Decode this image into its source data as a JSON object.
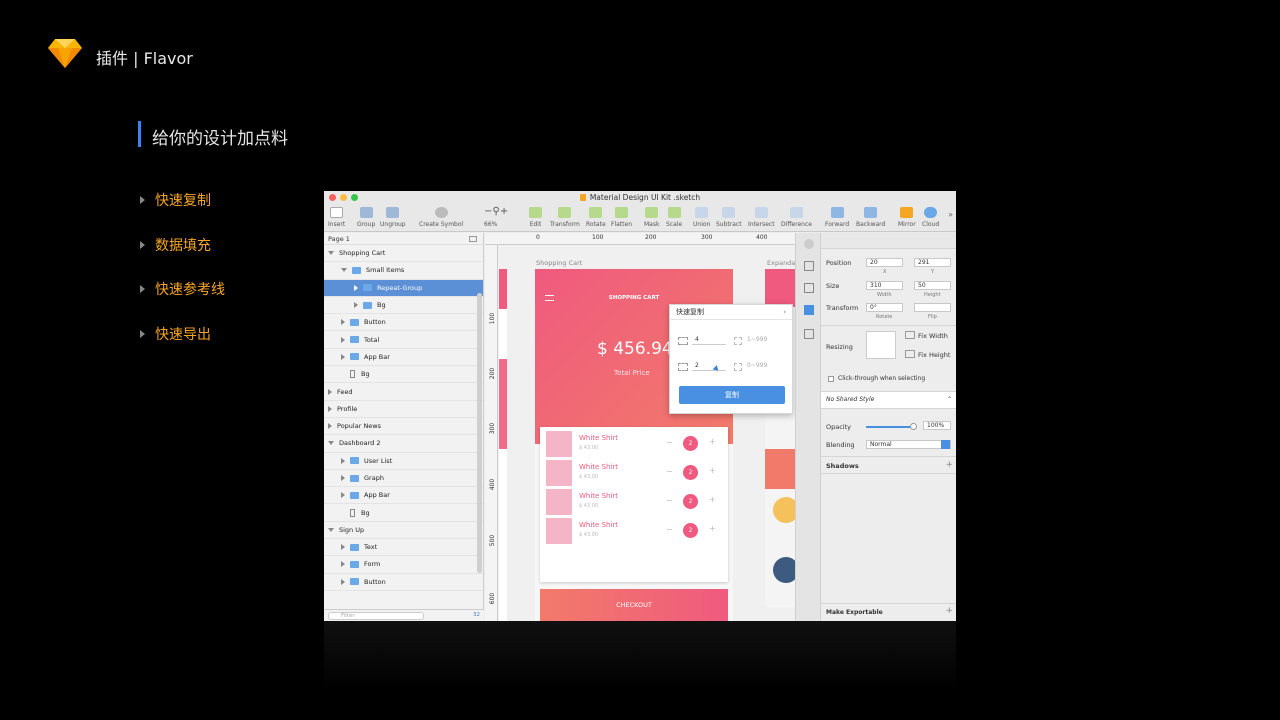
{
  "header": {
    "title": "插件 | Flavor",
    "logo_icon": "sketch-diamond-icon"
  },
  "section": {
    "title": "给你的设计加点料"
  },
  "bullets": [
    "快速复制",
    "数据填充",
    "快速参考线",
    "快速导出"
  ],
  "colors": {
    "accent": "#f5a623",
    "bar": "#3b82f6",
    "pink": "#ef5a7e",
    "selection": "#5b8fd6"
  },
  "window": {
    "title": "Material Design UI Kit .sketch",
    "toolbar": {
      "left": [
        "Insert",
        "Group",
        "Ungroup",
        "Create Symbol"
      ],
      "zoom": "66%",
      "middle": [
        "Edit",
        "Transform",
        "Rotate",
        "Flatten",
        "Mask",
        "Scale",
        "Union",
        "Subtract",
        "Intersect",
        "Difference"
      ],
      "right": [
        "Forward",
        "Backward",
        "Mirror",
        "Cloud"
      ]
    },
    "page": "Page 1",
    "layers": [
      {
        "label": "Shopping Cart",
        "indent": 0,
        "arrow": "d",
        "icon": "none",
        "selected": false
      },
      {
        "label": "Small Items",
        "indent": 1,
        "arrow": "d",
        "icon": "folder",
        "selected": false
      },
      {
        "label": "Repeat-Group",
        "indent": 2,
        "arrow": "r",
        "icon": "folder",
        "selected": true
      },
      {
        "label": "Bg",
        "indent": 2,
        "arrow": "r",
        "icon": "folder",
        "selected": false
      },
      {
        "label": "Button",
        "indent": 1,
        "arrow": "r",
        "icon": "folder",
        "selected": false
      },
      {
        "label": "Total",
        "indent": 1,
        "arrow": "r",
        "icon": "folder",
        "selected": false
      },
      {
        "label": "App Bar",
        "indent": 1,
        "arrow": "r",
        "icon": "folder",
        "selected": false
      },
      {
        "label": "Bg",
        "indent": 1,
        "arrow": "none",
        "icon": "rect",
        "selected": false
      },
      {
        "label": "Feed",
        "indent": 0,
        "arrow": "r",
        "icon": "none",
        "selected": false
      },
      {
        "label": "Profile",
        "indent": 0,
        "arrow": "r",
        "icon": "none",
        "selected": false
      },
      {
        "label": "Popular News",
        "indent": 0,
        "arrow": "r",
        "icon": "none",
        "selected": false
      },
      {
        "label": "Dashboard 2",
        "indent": 0,
        "arrow": "d",
        "icon": "none",
        "selected": false
      },
      {
        "label": "User List",
        "indent": 1,
        "arrow": "r",
        "icon": "folder",
        "selected": false
      },
      {
        "label": "Graph",
        "indent": 1,
        "arrow": "r",
        "icon": "folder",
        "selected": false
      },
      {
        "label": "App Bar",
        "indent": 1,
        "arrow": "r",
        "icon": "folder",
        "selected": false
      },
      {
        "label": "Bg",
        "indent": 1,
        "arrow": "none",
        "icon": "rect",
        "selected": false
      },
      {
        "label": "Sign Up",
        "indent": 0,
        "arrow": "d",
        "icon": "none",
        "selected": false
      },
      {
        "label": "Text",
        "indent": 1,
        "arrow": "r",
        "icon": "folder",
        "selected": false
      },
      {
        "label": "Form",
        "indent": 1,
        "arrow": "r",
        "icon": "folder",
        "selected": false
      },
      {
        "label": "Button",
        "indent": 1,
        "arrow": "r",
        "icon": "folder",
        "selected": false
      }
    ],
    "filter_placeholder": "Filter",
    "layer_count": "32",
    "ruler_h": [
      "0",
      "100",
      "200",
      "300",
      "400"
    ],
    "ruler_v": [
      "100",
      "200",
      "300",
      "400",
      "500",
      "600"
    ],
    "artboards": {
      "left": "Shopping Cart",
      "right": "Expanda"
    },
    "app": {
      "bar_title": "SHOPPING CART",
      "price": "$ 456.94",
      "total_label": "Total Price",
      "items": [
        {
          "name": "White Shirt",
          "price": "$ 43.00",
          "qty": "2"
        },
        {
          "name": "White Shirt",
          "price": "$ 43.00",
          "qty": "2"
        },
        {
          "name": "White Shirt",
          "price": "$ 43.00",
          "qty": "2"
        },
        {
          "name": "White Shirt",
          "price": "$ 43.00",
          "qty": "2"
        }
      ],
      "checkout": "CHECKOUT"
    },
    "popup": {
      "title": "快速复制",
      "cols_value": "4",
      "cols_placeholder": "1~999",
      "rows_value": "2",
      "rows_placeholder": "0~999",
      "button": "复制"
    },
    "inspector": {
      "position_label": "Position",
      "x": "20",
      "y": "291",
      "x_sub": "X",
      "y_sub": "Y",
      "size_label": "Size",
      "w": "310",
      "h": "50",
      "w_sub": "Width",
      "h_sub": "Height",
      "transform_label": "Transform",
      "rotate": "0°",
      "rotate_sub": "Rotate",
      "flip_sub": "Flip",
      "resizing_label": "Resizing",
      "fix_width": "Fix Width",
      "fix_height": "Fix Height",
      "clickthrough": "Click-through when selecting",
      "style": "No Shared Style",
      "opacity_label": "Opacity",
      "opacity": "100%",
      "blending_label": "Blending",
      "blending": "Normal",
      "shadows": "Shadows",
      "export": "Make Exportable"
    }
  }
}
